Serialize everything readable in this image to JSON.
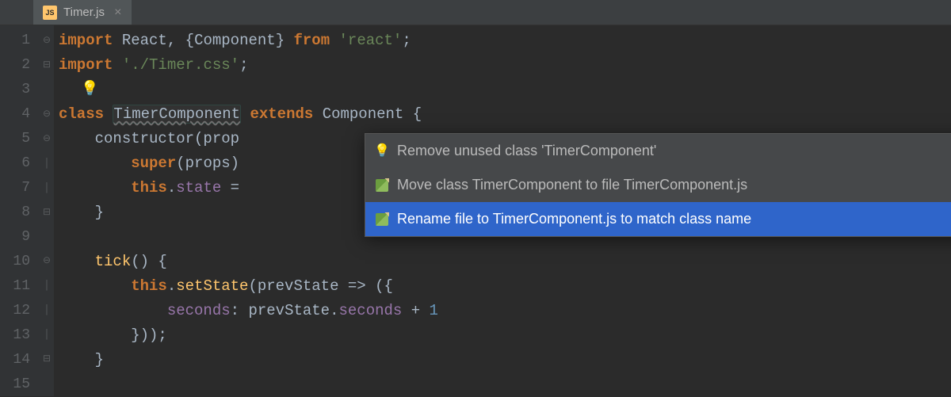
{
  "tab": {
    "icon_label": "JS",
    "filename": "Timer.js",
    "close_glyph": "×"
  },
  "gutter_lines": [
    "1",
    "2",
    "3",
    "4",
    "5",
    "6",
    "7",
    "8",
    "9",
    "10",
    "11",
    "12",
    "13",
    "14",
    "15"
  ],
  "code": {
    "line1": {
      "kw1": "import",
      "sp1": " ",
      "id1": "React",
      "sp2": ", {",
      "id2": "Component",
      "sp3": "} ",
      "kw2": "from",
      "sp4": " ",
      "str": "'react'",
      "end": ";"
    },
    "line2": {
      "kw": "import",
      "sp": " ",
      "str": "'./Timer.css'",
      "end": ";"
    },
    "line4": {
      "kw1": "class",
      "sp1": " ",
      "cls": "TimerComponent",
      "sp2": " ",
      "kw2": "extends",
      "sp3": " ",
      "sup": "Component",
      "brace": " {"
    },
    "line5": {
      "indent": "    ",
      "fn": "constructor",
      "args": "(prop"
    },
    "line6": {
      "indent": "        ",
      "kw": "super",
      "args": "(props)"
    },
    "line7": {
      "indent": "        ",
      "kw": "this",
      "dot": ".",
      "prop": "state",
      "sp": " ="
    },
    "line8": {
      "indent": "    ",
      "brace": "}"
    },
    "line10": {
      "indent": "    ",
      "fn": "tick",
      "rest": "() {"
    },
    "line11": {
      "indent": "        ",
      "kw": "this",
      "dot": ".",
      "fn": "setState",
      "rest": "(prevState => ({"
    },
    "line12": {
      "indent": "            ",
      "prop": "seconds",
      "mid": ": prevState.",
      "prop2": "seconds",
      "sp": " + ",
      "num": "1"
    },
    "line13": {
      "indent": "        ",
      "rest": "}));"
    },
    "line14": {
      "indent": "    ",
      "brace": "}"
    }
  },
  "bulb_glyph": "💡",
  "popup": {
    "items": [
      {
        "icon": "bulb",
        "label": "Remove unused class 'TimerComponent'",
        "selected": false
      },
      {
        "icon": "pencil",
        "label": "Move class TimerComponent to file TimerComponent.js",
        "selected": false
      },
      {
        "icon": "pencil",
        "label": "Rename file to TimerComponent.js to match class name",
        "selected": true
      }
    ],
    "arrow_glyph": "▶"
  }
}
